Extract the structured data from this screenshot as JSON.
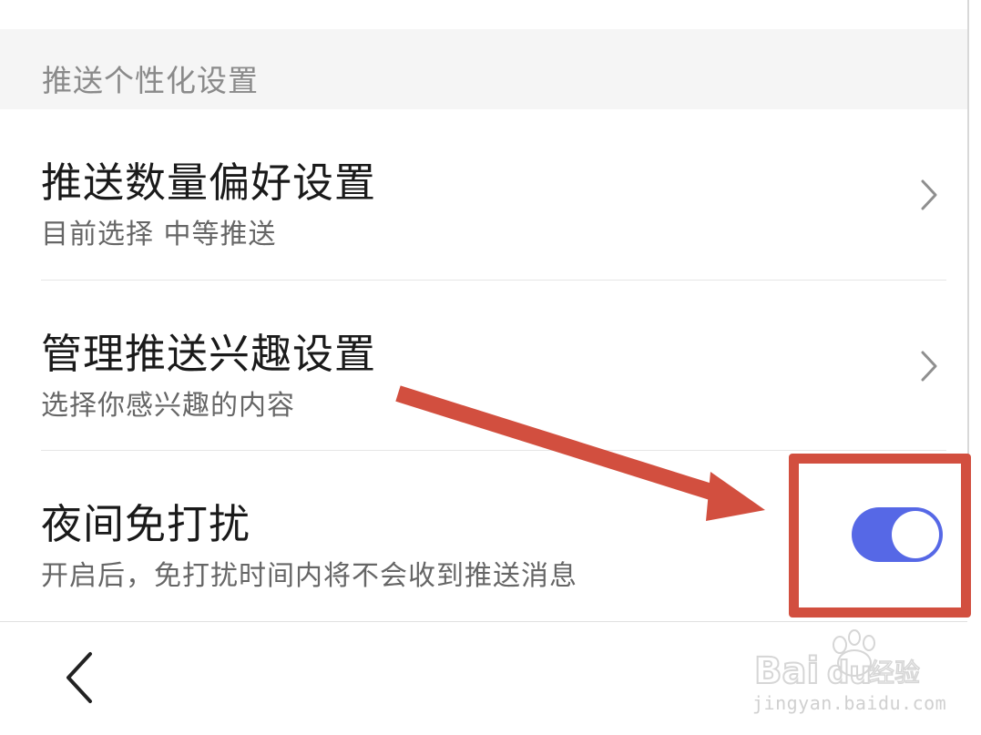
{
  "section": {
    "title": "推送个性化设置"
  },
  "items": [
    {
      "label": "推送数量偏好设置",
      "subtitle": "目前选择 中等推送",
      "icon": "chevron-right-icon"
    },
    {
      "label": "管理推送兴趣设置",
      "subtitle": "选择你感兴趣的内容",
      "icon": "chevron-right-icon"
    },
    {
      "label": "夜间免打扰",
      "subtitle": "开启后，免打扰时间内将不会收到推送消息",
      "toggle_on": true
    }
  ],
  "nav": {
    "back_icon": "chevron-left-icon"
  },
  "colors": {
    "toggle_on": "#5668e6",
    "annotation": "#d24f3f",
    "section_bg": "#f5f5f5"
  },
  "watermark": {
    "url": "jingyan.baidu.com"
  }
}
